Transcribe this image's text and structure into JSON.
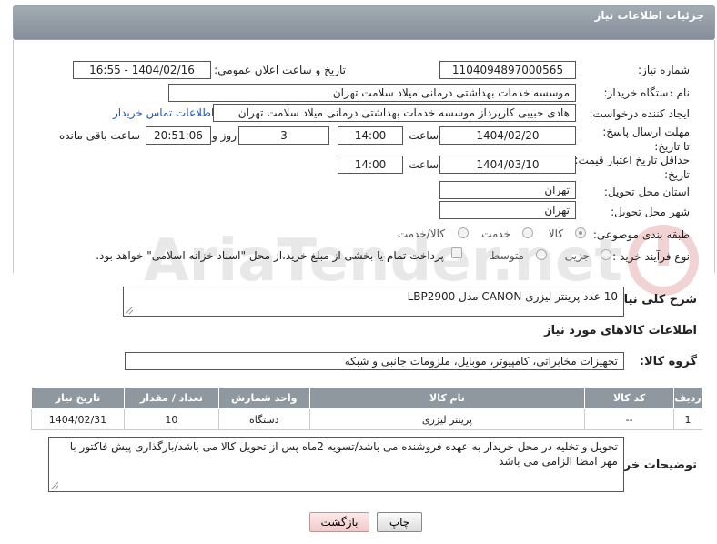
{
  "header": {
    "title": "جزئیات اطلاعات نیاز"
  },
  "labels": {
    "need_number": "شماره نیاز:",
    "announce_datetime": "تاریخ و ساعت اعلان عمومی:",
    "buyer_org": "نام دستگاه خریدار:",
    "requester": "ایجاد کننده درخواست:",
    "reply_deadline": "مهلت ارسال پاسخ: تا تاریخ:",
    "time": "ساعت",
    "days_and": "روز و",
    "time_remaining": "ساعت باقی مانده",
    "price_validity": "حداقل تاریخ اعتبار قیمت: تا تاریخ:",
    "time2": "ساعت",
    "delivery_province": "استان محل تحویل:",
    "delivery_city": "شهر محل تحویل:",
    "category": "طبقه بندی موضوعی:",
    "process_type": "نوع فرآیند خرید :",
    "general_desc": "شرح کلی نیاز:",
    "goods_info": "اطلاعات کالاهای مورد نیاز",
    "goods_group": "گروه کالا:",
    "buyer_notes": "توضیحات خریدار:"
  },
  "values": {
    "need_number": "1104094897000565",
    "announce_datetime": "1404/02/16 - 16:55",
    "buyer_org": "موسسه خدمات بهداشتی درمانی میلاد سلامت تهران",
    "requester": "هادی حبیبی کارپرداز موسسه خدمات بهداشتی درمانی میلاد سلامت تهران",
    "contact_link": "اطلاعات تماس خریدار",
    "reply_date": "1404/02/20",
    "reply_time": "14:00",
    "days": "3",
    "remaining": "20:51:06",
    "price_date": "1404/03/10",
    "price_time": "14:00",
    "province": "تهران",
    "city": "تهران",
    "general_desc": "10 عدد پرینتر لیزری CANON مدل LBP2900",
    "goods_group": "تجهیزات مخابراتی، کامپیوتر، موبایل، ملزومات جانبی و شبکه",
    "buyer_notes": "تحویل و تخلیه در محل خریدار به عهده فروشنده می باشد/تسویه 2ماه پس از تحویل کالا می باشد/بارگذاری پیش فاکتور با مهر امضا الزامی می باشد"
  },
  "category_options": [
    {
      "label": "کالا",
      "selected": true
    },
    {
      "label": "خدمت",
      "selected": false
    },
    {
      "label": "کالا/خدمت",
      "selected": false
    }
  ],
  "process_options": [
    {
      "label": "جزیی",
      "selected": false
    },
    {
      "label": "متوسط",
      "selected": false
    }
  ],
  "payment_note": "پرداخت تمام یا بخشی از مبلغ خرید،از محل \"اسناد خزانه اسلامی\" خواهد بود.",
  "table": {
    "headers": [
      "ردیف",
      "کد کالا",
      "نام کالا",
      "واحد شمارش",
      "تعداد / مقدار",
      "تاریخ نیاز"
    ],
    "rows": [
      [
        "1",
        "--",
        "پرینتر لیزری",
        "دستگاه",
        "10",
        "1404/02/31"
      ]
    ]
  },
  "buttons": {
    "print": "چاپ",
    "back": "بازگشت"
  },
  "watermark": {
    "text": "AriaTender.net",
    "color": "#9a9a9a",
    "accent": "#c43a3a"
  }
}
